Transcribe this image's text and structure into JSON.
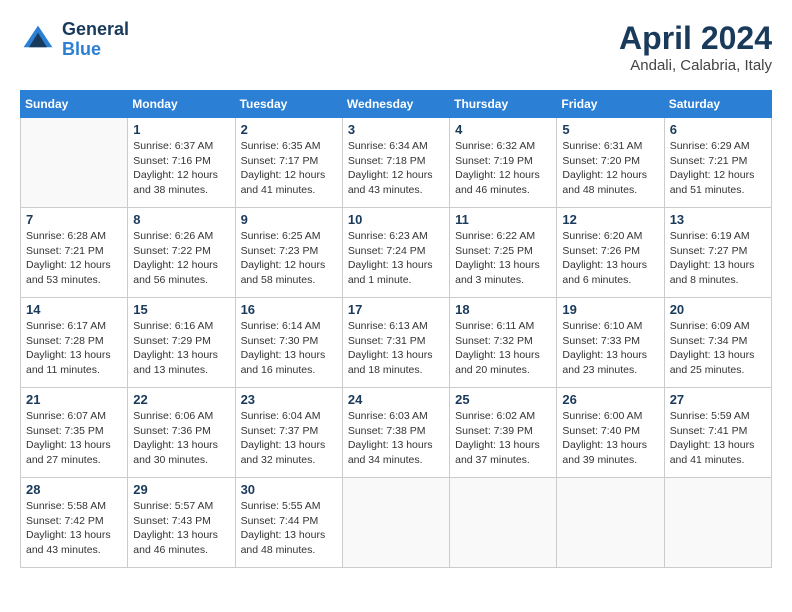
{
  "logo": {
    "line1": "General",
    "line2": "Blue"
  },
  "title": "April 2024",
  "subtitle": "Andali, Calabria, Italy",
  "days_of_week": [
    "Sunday",
    "Monday",
    "Tuesday",
    "Wednesday",
    "Thursday",
    "Friday",
    "Saturday"
  ],
  "weeks": [
    [
      {
        "day": "",
        "sunrise": "",
        "sunset": "",
        "daylight": ""
      },
      {
        "day": "1",
        "sunrise": "Sunrise: 6:37 AM",
        "sunset": "Sunset: 7:16 PM",
        "daylight": "Daylight: 12 hours and 38 minutes."
      },
      {
        "day": "2",
        "sunrise": "Sunrise: 6:35 AM",
        "sunset": "Sunset: 7:17 PM",
        "daylight": "Daylight: 12 hours and 41 minutes."
      },
      {
        "day": "3",
        "sunrise": "Sunrise: 6:34 AM",
        "sunset": "Sunset: 7:18 PM",
        "daylight": "Daylight: 12 hours and 43 minutes."
      },
      {
        "day": "4",
        "sunrise": "Sunrise: 6:32 AM",
        "sunset": "Sunset: 7:19 PM",
        "daylight": "Daylight: 12 hours and 46 minutes."
      },
      {
        "day": "5",
        "sunrise": "Sunrise: 6:31 AM",
        "sunset": "Sunset: 7:20 PM",
        "daylight": "Daylight: 12 hours and 48 minutes."
      },
      {
        "day": "6",
        "sunrise": "Sunrise: 6:29 AM",
        "sunset": "Sunset: 7:21 PM",
        "daylight": "Daylight: 12 hours and 51 minutes."
      }
    ],
    [
      {
        "day": "7",
        "sunrise": "Sunrise: 6:28 AM",
        "sunset": "Sunset: 7:21 PM",
        "daylight": "Daylight: 12 hours and 53 minutes."
      },
      {
        "day": "8",
        "sunrise": "Sunrise: 6:26 AM",
        "sunset": "Sunset: 7:22 PM",
        "daylight": "Daylight: 12 hours and 56 minutes."
      },
      {
        "day": "9",
        "sunrise": "Sunrise: 6:25 AM",
        "sunset": "Sunset: 7:23 PM",
        "daylight": "Daylight: 12 hours and 58 minutes."
      },
      {
        "day": "10",
        "sunrise": "Sunrise: 6:23 AM",
        "sunset": "Sunset: 7:24 PM",
        "daylight": "Daylight: 13 hours and 1 minute."
      },
      {
        "day": "11",
        "sunrise": "Sunrise: 6:22 AM",
        "sunset": "Sunset: 7:25 PM",
        "daylight": "Daylight: 13 hours and 3 minutes."
      },
      {
        "day": "12",
        "sunrise": "Sunrise: 6:20 AM",
        "sunset": "Sunset: 7:26 PM",
        "daylight": "Daylight: 13 hours and 6 minutes."
      },
      {
        "day": "13",
        "sunrise": "Sunrise: 6:19 AM",
        "sunset": "Sunset: 7:27 PM",
        "daylight": "Daylight: 13 hours and 8 minutes."
      }
    ],
    [
      {
        "day": "14",
        "sunrise": "Sunrise: 6:17 AM",
        "sunset": "Sunset: 7:28 PM",
        "daylight": "Daylight: 13 hours and 11 minutes."
      },
      {
        "day": "15",
        "sunrise": "Sunrise: 6:16 AM",
        "sunset": "Sunset: 7:29 PM",
        "daylight": "Daylight: 13 hours and 13 minutes."
      },
      {
        "day": "16",
        "sunrise": "Sunrise: 6:14 AM",
        "sunset": "Sunset: 7:30 PM",
        "daylight": "Daylight: 13 hours and 16 minutes."
      },
      {
        "day": "17",
        "sunrise": "Sunrise: 6:13 AM",
        "sunset": "Sunset: 7:31 PM",
        "daylight": "Daylight: 13 hours and 18 minutes."
      },
      {
        "day": "18",
        "sunrise": "Sunrise: 6:11 AM",
        "sunset": "Sunset: 7:32 PM",
        "daylight": "Daylight: 13 hours and 20 minutes."
      },
      {
        "day": "19",
        "sunrise": "Sunrise: 6:10 AM",
        "sunset": "Sunset: 7:33 PM",
        "daylight": "Daylight: 13 hours and 23 minutes."
      },
      {
        "day": "20",
        "sunrise": "Sunrise: 6:09 AM",
        "sunset": "Sunset: 7:34 PM",
        "daylight": "Daylight: 13 hours and 25 minutes."
      }
    ],
    [
      {
        "day": "21",
        "sunrise": "Sunrise: 6:07 AM",
        "sunset": "Sunset: 7:35 PM",
        "daylight": "Daylight: 13 hours and 27 minutes."
      },
      {
        "day": "22",
        "sunrise": "Sunrise: 6:06 AM",
        "sunset": "Sunset: 7:36 PM",
        "daylight": "Daylight: 13 hours and 30 minutes."
      },
      {
        "day": "23",
        "sunrise": "Sunrise: 6:04 AM",
        "sunset": "Sunset: 7:37 PM",
        "daylight": "Daylight: 13 hours and 32 minutes."
      },
      {
        "day": "24",
        "sunrise": "Sunrise: 6:03 AM",
        "sunset": "Sunset: 7:38 PM",
        "daylight": "Daylight: 13 hours and 34 minutes."
      },
      {
        "day": "25",
        "sunrise": "Sunrise: 6:02 AM",
        "sunset": "Sunset: 7:39 PM",
        "daylight": "Daylight: 13 hours and 37 minutes."
      },
      {
        "day": "26",
        "sunrise": "Sunrise: 6:00 AM",
        "sunset": "Sunset: 7:40 PM",
        "daylight": "Daylight: 13 hours and 39 minutes."
      },
      {
        "day": "27",
        "sunrise": "Sunrise: 5:59 AM",
        "sunset": "Sunset: 7:41 PM",
        "daylight": "Daylight: 13 hours and 41 minutes."
      }
    ],
    [
      {
        "day": "28",
        "sunrise": "Sunrise: 5:58 AM",
        "sunset": "Sunset: 7:42 PM",
        "daylight": "Daylight: 13 hours and 43 minutes."
      },
      {
        "day": "29",
        "sunrise": "Sunrise: 5:57 AM",
        "sunset": "Sunset: 7:43 PM",
        "daylight": "Daylight: 13 hours and 46 minutes."
      },
      {
        "day": "30",
        "sunrise": "Sunrise: 5:55 AM",
        "sunset": "Sunset: 7:44 PM",
        "daylight": "Daylight: 13 hours and 48 minutes."
      },
      {
        "day": "",
        "sunrise": "",
        "sunset": "",
        "daylight": ""
      },
      {
        "day": "",
        "sunrise": "",
        "sunset": "",
        "daylight": ""
      },
      {
        "day": "",
        "sunrise": "",
        "sunset": "",
        "daylight": ""
      },
      {
        "day": "",
        "sunrise": "",
        "sunset": "",
        "daylight": ""
      }
    ]
  ]
}
